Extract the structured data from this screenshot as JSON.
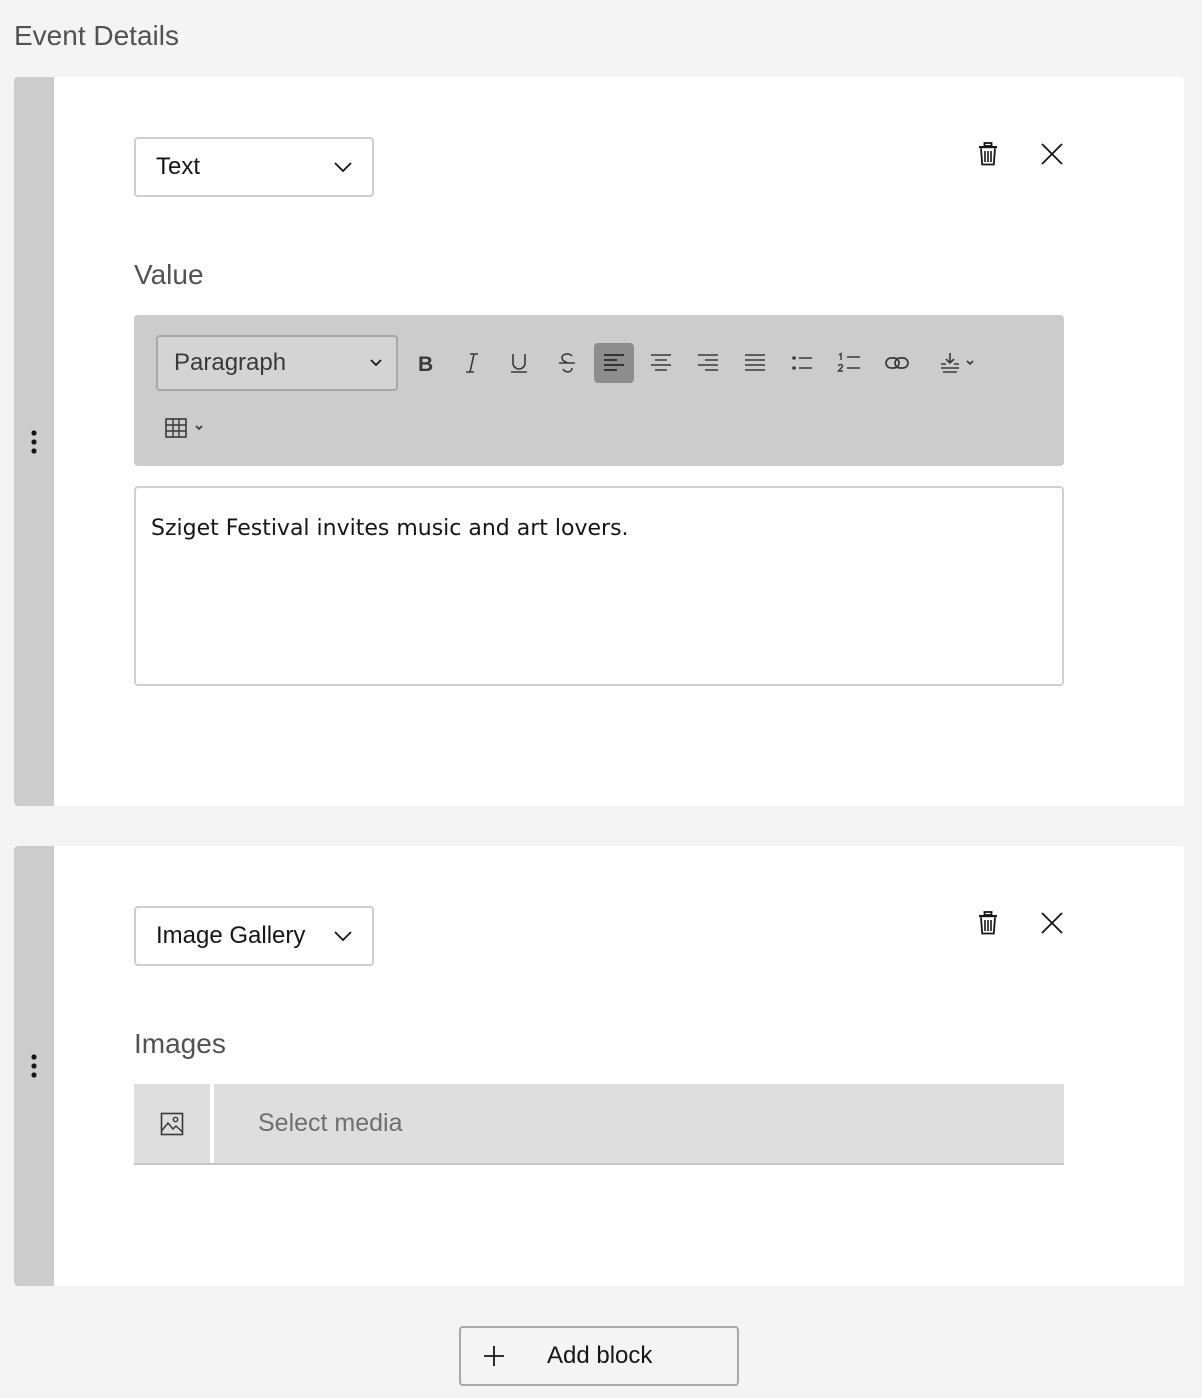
{
  "section": {
    "title": "Event Details"
  },
  "blocks": [
    {
      "type_value": "Text",
      "field_label": "Value",
      "toolbar": {
        "format_select": "Paragraph",
        "buttons": [
          "bold-icon",
          "italic-icon",
          "underline-icon",
          "strikethrough-icon",
          "align-left-icon",
          "align-center-icon",
          "align-right-icon",
          "align-justify-icon",
          "bullet-list-icon",
          "numbered-list-icon",
          "link-icon",
          "insert-icon",
          "table-icon"
        ],
        "active_button": "align-left-icon"
      },
      "content": "Sziget Festival invites music and art lovers."
    },
    {
      "type_value": "Image Gallery",
      "field_label": "Images",
      "media": {
        "placeholder": "Select media",
        "icon": "image-icon"
      }
    }
  ],
  "actions": {
    "add_block": "Add block"
  },
  "colors": {
    "background": "#f4f4f4",
    "handle": "#cccccc",
    "toolbar": "#cccccc",
    "active_tool": "#8d8d8d",
    "media_row": "#dedede"
  }
}
